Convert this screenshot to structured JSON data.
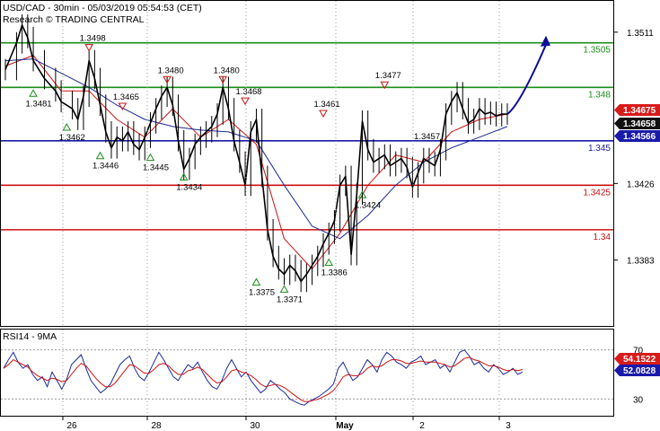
{
  "header": {
    "title": "USD/CAD - 30min - 05/03/2019 05:54:53 (CET)",
    "subtitle": "Research © TRADING CENTRAL"
  },
  "chart_data": [
    {
      "type": "line",
      "name_label": "",
      "price_axis_ticks": [
        "1.3511",
        "1.3426",
        "1.3383"
      ],
      "x_ticks": [
        "26",
        "28",
        "30",
        "May",
        "2",
        "3"
      ],
      "ylim": [
        1.335,
        1.352
      ],
      "series": [
        {
          "role": "price",
          "color": "#000000",
          "points": [
            [
              0,
              1.349
            ],
            [
              2,
              1.3505
            ],
            [
              3,
              1.3515
            ],
            [
              4,
              1.3508
            ],
            [
              5,
              1.3495
            ],
            [
              7,
              1.3485
            ],
            [
              9,
              1.3478
            ],
            [
              10,
              1.3472
            ],
            [
              12,
              1.3468
            ],
            [
              13,
              1.3462
            ],
            [
              14,
              1.3475
            ],
            [
              15,
              1.3495
            ],
            [
              16,
              1.3485
            ],
            [
              17,
              1.347
            ],
            [
              18,
              1.3455
            ],
            [
              19,
              1.3446
            ],
            [
              20,
              1.3452
            ],
            [
              21,
              1.345
            ],
            [
              22,
              1.3455
            ],
            [
              23,
              1.3448
            ],
            [
              24,
              1.3445
            ],
            [
              25,
              1.3452
            ],
            [
              26,
              1.346
            ],
            [
              27,
              1.3468
            ],
            [
              28,
              1.3475
            ],
            [
              29,
              1.348
            ],
            [
              30,
              1.347
            ],
            [
              31,
              1.345
            ],
            [
              32,
              1.3434
            ],
            [
              33,
              1.344
            ],
            [
              34,
              1.3448
            ],
            [
              35,
              1.3452
            ],
            [
              36,
              1.3455
            ],
            [
              37,
              1.3458
            ],
            [
              38,
              1.3465
            ],
            [
              39,
              1.348
            ],
            [
              40,
              1.3468
            ],
            [
              41,
              1.345
            ],
            [
              42,
              1.3438
            ],
            [
              43,
              1.3425
            ],
            [
              44,
              1.3455
            ],
            [
              45,
              1.3462
            ],
            [
              46,
              1.343
            ],
            [
              47,
              1.34
            ],
            [
              48,
              1.3385
            ],
            [
              49,
              1.3378
            ],
            [
              50,
              1.3375
            ],
            [
              51,
              1.338
            ],
            [
              52,
              1.3377
            ],
            [
              53,
              1.3371
            ],
            [
              54,
              1.3375
            ],
            [
              55,
              1.338
            ],
            [
              56,
              1.3385
            ],
            [
              57,
              1.3392
            ],
            [
              58,
              1.3398
            ],
            [
              59,
              1.3405
            ],
            [
              60,
              1.3425
            ],
            [
              61,
              1.343
            ],
            [
              62,
              1.3386
            ],
            [
              63,
              1.342
            ],
            [
              64,
              1.3461
            ],
            [
              65,
              1.3445
            ],
            [
              66,
              1.3438
            ],
            [
              67,
              1.344
            ],
            [
              68,
              1.3442
            ],
            [
              69,
              1.3436
            ],
            [
              70,
              1.3438
            ],
            [
              71,
              1.344
            ],
            [
              72,
              1.3435
            ],
            [
              73,
              1.3424
            ],
            [
              74,
              1.3432
            ],
            [
              75,
              1.344
            ],
            [
              76,
              1.3438
            ],
            [
              77,
              1.3436
            ],
            [
              78,
              1.3445
            ],
            [
              79,
              1.3465
            ],
            [
              80,
              1.3472
            ],
            [
              81,
              1.3477
            ],
            [
              82,
              1.3468
            ],
            [
              83,
              1.346
            ],
            [
              84,
              1.3462
            ],
            [
              85,
              1.3468
            ],
            [
              86,
              1.3465
            ],
            [
              87,
              1.3466
            ],
            [
              88,
              1.3464
            ],
            [
              89,
              1.3465
            ],
            [
              90,
              1.3465
            ]
          ]
        },
        {
          "role": "ma-fast",
          "color": "#cc1111",
          "points": [
            [
              0,
              1.3492
            ],
            [
              5,
              1.3498
            ],
            [
              10,
              1.3478
            ],
            [
              15,
              1.3478
            ],
            [
              20,
              1.3462
            ],
            [
              25,
              1.3452
            ],
            [
              30,
              1.3468
            ],
            [
              35,
              1.3452
            ],
            [
              40,
              1.3462
            ],
            [
              45,
              1.3448
            ],
            [
              50,
              1.3395
            ],
            [
              55,
              1.3378
            ],
            [
              60,
              1.3398
            ],
            [
              65,
              1.3425
            ],
            [
              70,
              1.3442
            ],
            [
              75,
              1.3438
            ],
            [
              80,
              1.3455
            ],
            [
              85,
              1.3462
            ],
            [
              90,
              1.3465
            ]
          ]
        },
        {
          "role": "ma-slow",
          "color": "#1a2a99",
          "points": [
            [
              0,
              1.3495
            ],
            [
              5,
              1.3496
            ],
            [
              10,
              1.3488
            ],
            [
              15,
              1.348
            ],
            [
              20,
              1.347
            ],
            [
              25,
              1.3462
            ],
            [
              30,
              1.3458
            ],
            [
              35,
              1.3456
            ],
            [
              40,
              1.3455
            ],
            [
              45,
              1.345
            ],
            [
              50,
              1.3425
            ],
            [
              55,
              1.3402
            ],
            [
              60,
              1.3395
            ],
            [
              65,
              1.3408
            ],
            [
              70,
              1.3425
            ],
            [
              75,
              1.3438
            ],
            [
              80,
              1.3446
            ],
            [
              85,
              1.3452
            ],
            [
              90,
              1.3458
            ]
          ]
        }
      ],
      "projection": {
        "from": [
          90,
          1.3465
        ],
        "to": [
          95,
          1.3507
        ],
        "color": "#0a0a99"
      },
      "levels": [
        {
          "value": 1.3505,
          "label": "1.3505",
          "color": "#1a8f1a"
        },
        {
          "value": 1.348,
          "label": "1.348",
          "color": "#1a8f1a"
        },
        {
          "value": 1.345,
          "label": "1.345",
          "color": "#1a1aaa"
        },
        {
          "value": 1.3425,
          "label": "1.3425",
          "color": "#cc1111"
        },
        {
          "value": 1.34,
          "label": "1.34",
          "color": "#cc1111"
        }
      ],
      "price_tags": [
        {
          "value": 1.3467,
          "label": "1.34675",
          "color": "#d81b1b"
        },
        {
          "value": 1.3465,
          "label": "1.34658",
          "color": "#111111"
        },
        {
          "value": 1.3456,
          "label": "1.34566",
          "color": "#1a1aaa"
        }
      ],
      "annotations": [
        {
          "x": 15,
          "y": 1.3498,
          "label": "1.3498",
          "kind": "high"
        },
        {
          "x": 29,
          "y": 1.348,
          "label": "1.3480",
          "kind": "high"
        },
        {
          "x": 39,
          "y": 1.348,
          "label": "1.3480",
          "kind": "high"
        },
        {
          "x": 21,
          "y": 1.3465,
          "label": "1.3465",
          "kind": "high"
        },
        {
          "x": 43,
          "y": 1.3468,
          "label": "1.3468",
          "kind": "high"
        },
        {
          "x": 57,
          "y": 1.3461,
          "label": "1.3461",
          "kind": "high"
        },
        {
          "x": 68,
          "y": 1.3477,
          "label": "1.3477",
          "kind": "high"
        },
        {
          "x": 5,
          "y": 1.3481,
          "label": "1.3481",
          "kind": "low"
        },
        {
          "x": 11,
          "y": 1.3462,
          "label": "1.3462",
          "kind": "low"
        },
        {
          "x": 17,
          "y": 1.3446,
          "label": "1.3446",
          "kind": "low"
        },
        {
          "x": 26,
          "y": 1.3445,
          "label": "1.3445",
          "kind": "low"
        },
        {
          "x": 32,
          "y": 1.3434,
          "label": "1.3434",
          "kind": "low"
        },
        {
          "x": 45,
          "y": 1.3375,
          "label": "1.3375",
          "kind": "low"
        },
        {
          "x": 50,
          "y": 1.3371,
          "label": "1.3371",
          "kind": "low"
        },
        {
          "x": 58,
          "y": 1.3386,
          "label": "1.3386",
          "kind": "low"
        },
        {
          "x": 64,
          "y": 1.3424,
          "label": "1.3424",
          "kind": "low"
        },
        {
          "x": 74,
          "y": 1.3457,
          "label": "1.3457",
          "kind": "low-plain"
        }
      ]
    },
    {
      "type": "line",
      "title": "RSI14 - 9MA",
      "ylim": [
        20,
        80
      ],
      "axis_ticks": [
        "70",
        "30"
      ],
      "tags": [
        {
          "value": 54.1522,
          "label": "54.1522",
          "color": "#d81b1b"
        },
        {
          "value": 52.0828,
          "label": "52.0828",
          "color": "#1a1aaa"
        }
      ],
      "series": [
        {
          "role": "rsi",
          "color": "#1a2a99",
          "values": [
            55,
            62,
            68,
            60,
            55,
            58,
            50,
            45,
            48,
            40,
            52,
            45,
            38,
            46,
            58,
            62,
            66,
            55,
            45,
            40,
            35,
            38,
            42,
            50,
            58,
            62,
            65,
            55,
            48,
            45,
            52,
            60,
            68,
            62,
            55,
            48,
            45,
            52,
            58,
            55,
            60,
            52,
            45,
            40,
            38,
            45,
            55,
            62,
            55,
            48,
            52,
            45,
            40,
            35,
            38,
            45,
            42,
            38,
            35,
            30,
            28,
            26,
            25,
            28,
            30,
            32,
            35,
            38,
            42,
            55,
            60,
            52,
            45,
            48,
            55,
            62,
            58,
            52,
            62,
            68,
            65,
            60,
            58,
            55,
            60,
            62,
            65,
            58,
            60,
            62,
            55,
            58,
            52,
            60,
            68,
            70,
            65,
            58,
            60,
            55,
            52,
            58,
            55,
            50,
            52,
            55,
            50,
            52
          ]
        },
        {
          "role": "rsi-ma",
          "color": "#cc1111",
          "values": [
            55,
            58,
            62,
            60,
            58,
            56,
            52,
            49,
            47,
            45,
            47,
            46,
            44,
            45,
            50,
            55,
            59,
            57,
            52,
            47,
            43,
            40,
            40,
            43,
            48,
            53,
            58,
            57,
            54,
            51,
            51,
            54,
            58,
            59,
            57,
            53,
            50,
            50,
            53,
            54,
            56,
            54,
            50,
            46,
            43,
            44,
            48,
            53,
            54,
            52,
            51,
            49,
            46,
            42,
            40,
            41,
            42,
            41,
            39,
            36,
            33,
            30,
            28,
            28,
            29,
            30,
            32,
            34,
            37,
            42,
            48,
            50,
            49,
            49,
            51,
            55,
            57,
            56,
            57,
            60,
            62,
            62,
            61,
            59,
            59,
            60,
            61,
            60,
            60,
            60,
            59,
            58,
            56,
            57,
            60,
            63,
            64,
            62,
            61,
            59,
            57,
            57,
            56,
            54,
            53,
            54,
            53,
            54
          ]
        }
      ]
    }
  ]
}
